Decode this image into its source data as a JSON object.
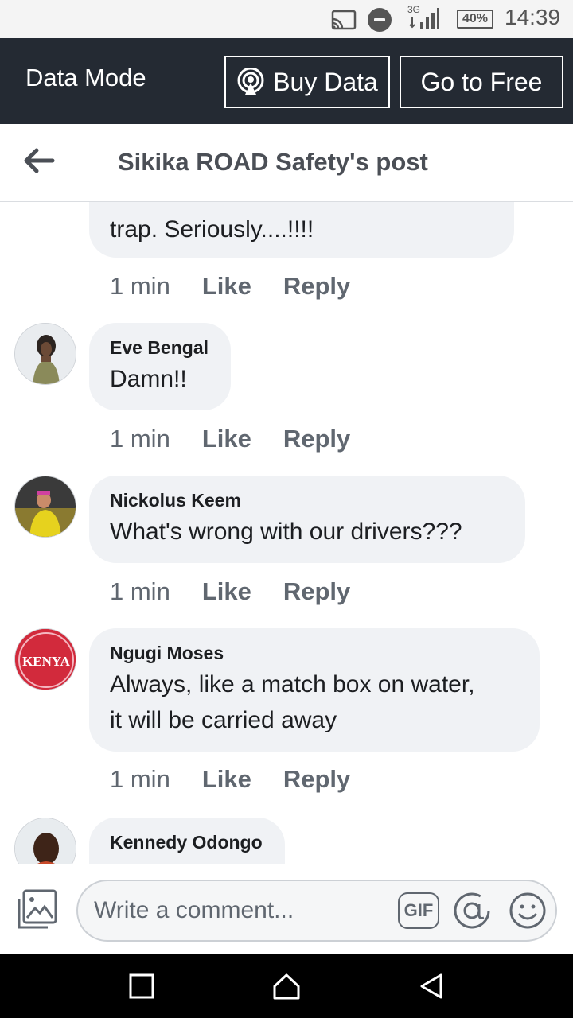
{
  "status_bar": {
    "battery": "40%",
    "network": "3G",
    "time": "14:39"
  },
  "data_bar": {
    "label": "Data Mode",
    "buy_label": "Buy Data",
    "free_label": "Go to Free"
  },
  "header": {
    "title": "Sikika ROAD Safety's post"
  },
  "comments": [
    {
      "author": "",
      "text": "trap. Seriously....!!!!",
      "time": "1 min",
      "like": "Like",
      "reply": "Reply"
    },
    {
      "author": "Eve Bengal",
      "text": "Damn!!",
      "time": "1 min",
      "like": "Like",
      "reply": "Reply"
    },
    {
      "author": "Nickolus Keem",
      "text": "What's wrong with our drivers???",
      "time": "1 min",
      "like": "Like",
      "reply": "Reply"
    },
    {
      "author": "Ngugi Moses",
      "text_line1": "Always, like a match box on water,",
      "text_line2": "it will be carried away",
      "time": "1 min",
      "like": "Like",
      "reply": "Reply"
    },
    {
      "author": "Kennedy Odongo"
    }
  ],
  "avatars": {
    "ngugi_text": "KENYA"
  },
  "composer": {
    "placeholder": "Write a comment...",
    "gif_label": "GIF"
  },
  "colors": {
    "data_bar_bg": "#242a33",
    "bubble_bg": "#f0f2f5",
    "muted_text": "#606770"
  }
}
